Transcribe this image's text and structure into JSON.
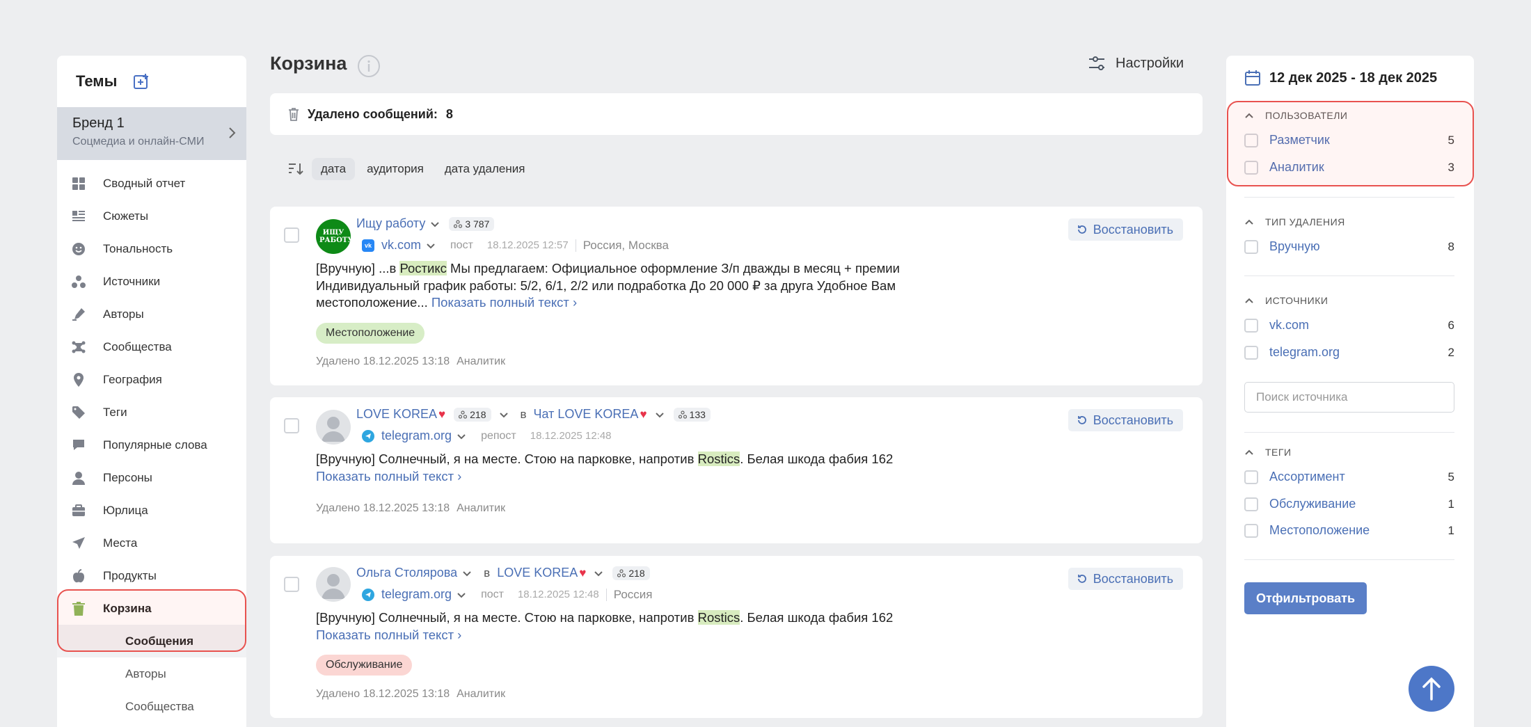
{
  "sidebar": {
    "title": "Темы",
    "brand": {
      "name": "Бренд 1",
      "subtitle": "Соцмедиа и онлайн-СМИ"
    },
    "nav": [
      {
        "label": "Сводный отчет",
        "icon": "grid-icon"
      },
      {
        "label": "Сюжеты",
        "icon": "list-icon"
      },
      {
        "label": "Тональность",
        "icon": "smile-icon"
      },
      {
        "label": "Источники",
        "icon": "sources-icon"
      },
      {
        "label": "Авторы",
        "icon": "pen-icon"
      },
      {
        "label": "Сообщества",
        "icon": "community-icon"
      },
      {
        "label": "География",
        "icon": "location-pin-icon"
      },
      {
        "label": "Теги",
        "icon": "tag-icon"
      },
      {
        "label": "Популярные слова",
        "icon": "chat-bubble-icon"
      },
      {
        "label": "Персоны",
        "icon": "person-icon"
      },
      {
        "label": "Юрлица",
        "icon": "briefcase-icon"
      },
      {
        "label": "Места",
        "icon": "navigation-arrow-icon"
      },
      {
        "label": "Продукты",
        "icon": "apple-icon"
      },
      {
        "label": "Корзина",
        "icon": "trash-icon"
      }
    ],
    "subnav": [
      "Сообщения",
      "Авторы",
      "Сообщества"
    ]
  },
  "main": {
    "title": "Корзина",
    "settings_label": "Настройки",
    "deleted_label": "Удалено сообщений:",
    "deleted_count": "8",
    "sort_options": [
      "дата",
      "аудитория",
      "дата удаления"
    ]
  },
  "posts": [
    {
      "author": "Ищу работу",
      "avatar_text": "ИЩУ РАБОТУ",
      "audience": "3 787",
      "source": "vk.com",
      "type": "пост",
      "date": "18.12.2025 12:57",
      "geo": "Россия, Москва",
      "text_before": "[Вручную] ...в ",
      "highlight": "Ростикс",
      "text_after": " Мы предлагаем: Официальное оформление З/п дважды в месяц + премии Индивидуальный график работы: 5/2, 6/1, 2/2 или подработка До 20 000 ₽ за друга Удобное Вам местоположение... ",
      "more": "Показать полный текст ›",
      "tag": "Местоположение",
      "deleted_prefix": "Удалено 18.12.2025 13:18",
      "deleted_by": "Аналитик",
      "restore": "Восстановить"
    },
    {
      "author": "LOVE KOREA",
      "audience": "218",
      "in": "в",
      "community": "Чат LOVE KOREA",
      "community_audience": "133",
      "source": "telegram.org",
      "type": "репост",
      "date": "18.12.2025 12:48",
      "text_before": "[Вручную] Солнечный, я на месте. Стою на парковке, напротив ",
      "highlight": "Rostics",
      "text_after": ". Белая шкода фабия 162  ",
      "more": "Показать полный текст ›",
      "deleted_prefix": "Удалено 18.12.2025 13:18",
      "deleted_by": "Аналитик",
      "restore": "Восстановить"
    },
    {
      "author": "Ольга Столярова",
      "in": "в",
      "community": "LOVE KOREA",
      "community_audience": "218",
      "source": "telegram.org",
      "type": "пост",
      "date": "18.12.2025 12:48",
      "geo": "Россия",
      "text_before": "[Вручную] Солнечный, я на месте. Стою на парковке, напротив ",
      "highlight": "Rostics",
      "text_after": ". Белая шкода фабия 162  ",
      "more": "Показать полный текст ›",
      "tag": "Обслуживание",
      "deleted_prefix": "Удалено 18.12.2025 13:18",
      "deleted_by": "Аналитик",
      "restore": "Восстановить"
    }
  ],
  "filters": {
    "date_range": "12 дек 2025 - 18 дек 2025",
    "users": {
      "title": "ПОЛЬЗОВАТЕЛИ",
      "items": [
        {
          "label": "Разметчик",
          "count": "5"
        },
        {
          "label": "Аналитик",
          "count": "3"
        }
      ]
    },
    "deletion_type": {
      "title": "ТИП УДАЛЕНИЯ",
      "items": [
        {
          "label": "Вручную",
          "count": "8"
        }
      ]
    },
    "sources": {
      "title": "ИСТОЧНИКИ",
      "items": [
        {
          "label": "vk.com",
          "count": "6"
        },
        {
          "label": "telegram.org",
          "count": "2"
        }
      ],
      "search_placeholder": "Поиск источника"
    },
    "tags": {
      "title": "ТЕГИ",
      "items": [
        {
          "label": "Ассортимент",
          "count": "5"
        },
        {
          "label": "Обслуживание",
          "count": "1"
        },
        {
          "label": "Местоположение",
          "count": "1"
        }
      ]
    },
    "apply_label": "Отфильтровать"
  },
  "colors": {
    "accent": "#4a6fb5",
    "highlight_border": "#e8524f",
    "tag_green": "#d7edc6",
    "tag_red": "#fbd6d3",
    "match_highlight": "#d8ecbf"
  }
}
